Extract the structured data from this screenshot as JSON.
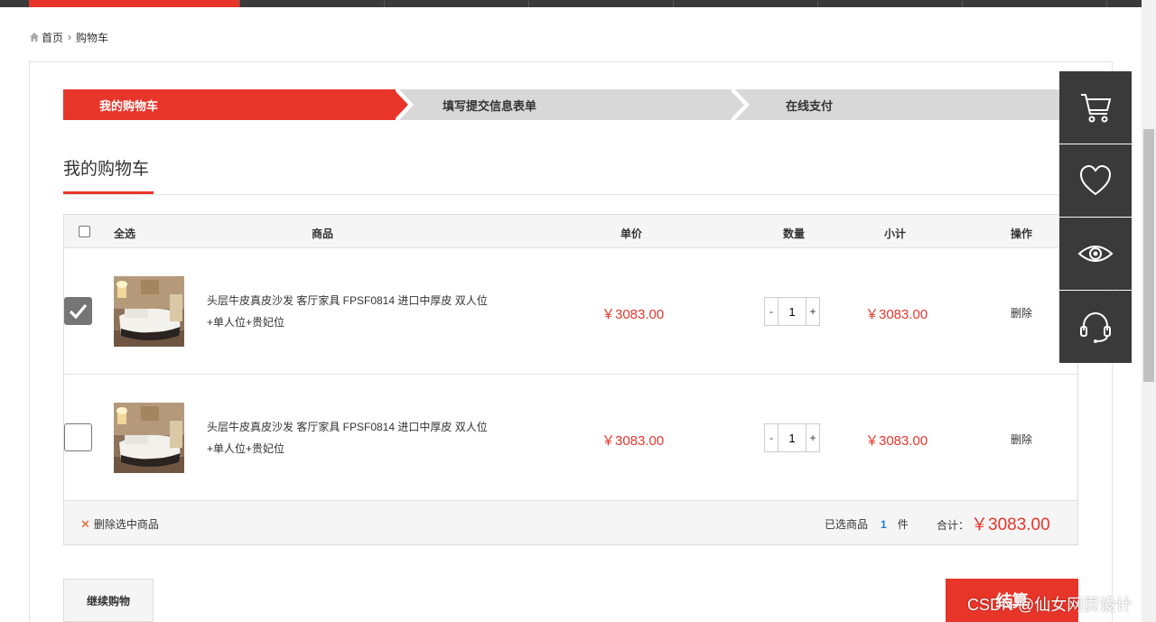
{
  "breadcrumb": {
    "home": "首页",
    "current": "购物车"
  },
  "steps": [
    {
      "label": "我的购物车"
    },
    {
      "label": "填写提交信息表单"
    },
    {
      "label": "在线支付"
    }
  ],
  "section": {
    "title": "我的购物车"
  },
  "table": {
    "headers": {
      "select_all": "全选",
      "product": "商品",
      "unit_price": "单价",
      "quantity": "数量",
      "subtotal": "小计",
      "action": "操作"
    },
    "rows": [
      {
        "checked": true,
        "name_line1": "头层牛皮真皮沙发 客厅家具 FPSF0814 进口中厚皮 双人位",
        "name_line2": "+单人位+贵妃位",
        "price": "￥3083.00",
        "qty": "1",
        "minus": "-",
        "plus": "+",
        "subtotal": "￥3083.00",
        "delete": "删除"
      },
      {
        "checked": false,
        "name_line1": "头层牛皮真皮沙发 客厅家具 FPSF0814 进口中厚皮 双人位",
        "name_line2": "+单人位+贵妃位",
        "price": "￥3083.00",
        "qty": "1",
        "minus": "-",
        "plus": "+",
        "subtotal": "￥3083.00",
        "delete": "删除"
      }
    ],
    "footer": {
      "delete_selected": "删除选中商品",
      "selected_prefix": "已选商品",
      "selected_count": "1",
      "selected_unit": "件",
      "total_label": "合计：",
      "total_value": "￥3083.00"
    }
  },
  "buttons": {
    "continue": "继续购物",
    "checkout": "结算"
  },
  "watermark": "CSDN @仙女网页设计",
  "colors": {
    "accent": "#e8352a",
    "dark": "#3a3a3a",
    "link_blue": "#1b7bd6"
  },
  "side_toolbar": [
    "cart-icon",
    "heart-icon",
    "eye-icon",
    "headset-icon"
  ]
}
